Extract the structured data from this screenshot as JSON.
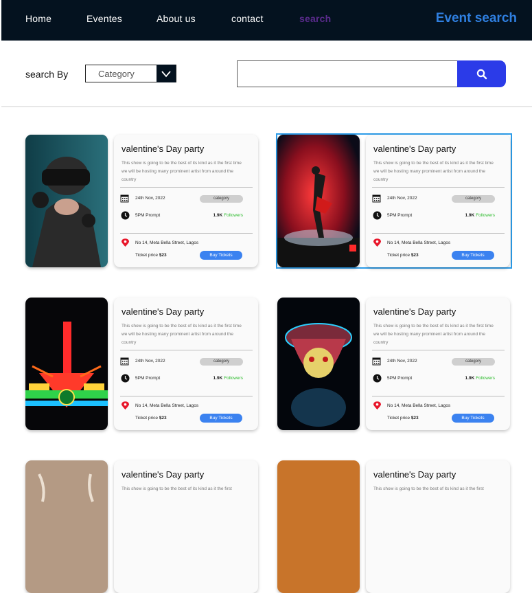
{
  "nav": {
    "links": [
      "Home",
      "Eventes",
      "About us",
      "contact",
      "search"
    ],
    "brand": "Event search"
  },
  "filter": {
    "label": "search By",
    "select_value": "Category",
    "search_placeholder": ""
  },
  "colors": {
    "nav_bg": "#04121f",
    "brand": "#2f7fe0",
    "active_link": "#5a2b8c",
    "search_button": "#2b3be8",
    "buy_button": "#3b82f0",
    "followers_green": "#2dbb2d",
    "selected_outline": "#2b9be8"
  },
  "events": [
    {
      "image": "vr-headset-photo",
      "title": "valentine's Day party",
      "description": "This show is going to be the best of its kind as it the first time we will be hosting many prominent artist from around the country",
      "date": "24th Nov, 2022",
      "category": "category",
      "time": "5PM Prompt",
      "followers_count": "1.9K",
      "followers_label": "Followers",
      "address": "No 14, Meta Bella Street, Lagos",
      "price_label": "Ticket price",
      "price": "$23",
      "buy_label": "Buy Tickets"
    },
    {
      "image": "dancer-photo",
      "title": "valentine's Day party",
      "description": "This show is going to be the best of its kind as it the first time we will be hosting many prominent artist from around the country",
      "date": "24th Nov, 2022",
      "category": "category",
      "time": "5PM Prompt",
      "followers_count": "1.9K",
      "followers_label": "Followers",
      "address": "No 14, Meta Bella Street, Lagos",
      "price_label": "Ticket price",
      "price": "$23",
      "buy_label": "Buy Tickets"
    },
    {
      "image": "regal-theatre-photo",
      "title": "valentine's Day party",
      "description": "This show is going to be the best of its kind as it the first time we will be hosting many prominent artist from around the country",
      "date": "24th Nov, 2022",
      "category": "category",
      "time": "5PM Prompt",
      "followers_count": "1.9K",
      "followers_label": "Followers",
      "address": "No 14, Meta Bella Street, Lagos",
      "price_label": "Ticket price",
      "price": "$23",
      "buy_label": "Buy Tickets"
    },
    {
      "image": "lantern-photo",
      "title": "valentine's Day party",
      "description": "This show is going to be the best of its kind as it the first time we will be hosting many prominent artist from around the country",
      "date": "24th Nov, 2022",
      "category": "category",
      "time": "5PM Prompt",
      "followers_count": "1.9K",
      "followers_label": "Followers",
      "address": "No 14, Meta Bella Street, Lagos",
      "price_label": "Ticket price",
      "price": "$23",
      "buy_label": "Buy Tickets"
    },
    {
      "image": "antlers-photo",
      "title": "valentine's Day party",
      "description": "This show is going to be the best of its kind as it the first"
    },
    {
      "image": "orange-photo",
      "title": "valentine's Day party",
      "description": "This show is going to be the best of its kind as it the first"
    }
  ]
}
